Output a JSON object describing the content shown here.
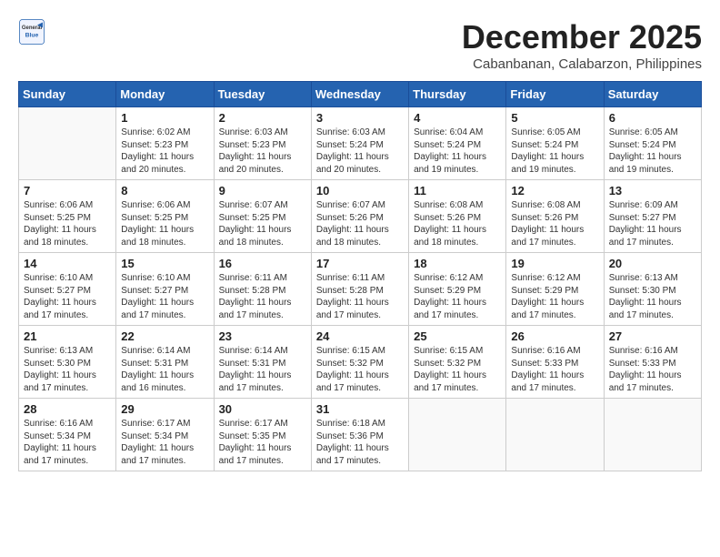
{
  "logo": {
    "general": "General",
    "blue": "Blue"
  },
  "header": {
    "title": "December 2025",
    "subtitle": "Cabanbanan, Calabarzon, Philippines"
  },
  "weekdays": [
    "Sunday",
    "Monday",
    "Tuesday",
    "Wednesday",
    "Thursday",
    "Friday",
    "Saturday"
  ],
  "weeks": [
    [
      {
        "day": "",
        "info": ""
      },
      {
        "day": "1",
        "info": "Sunrise: 6:02 AM\nSunset: 5:23 PM\nDaylight: 11 hours\nand 20 minutes."
      },
      {
        "day": "2",
        "info": "Sunrise: 6:03 AM\nSunset: 5:23 PM\nDaylight: 11 hours\nand 20 minutes."
      },
      {
        "day": "3",
        "info": "Sunrise: 6:03 AM\nSunset: 5:24 PM\nDaylight: 11 hours\nand 20 minutes."
      },
      {
        "day": "4",
        "info": "Sunrise: 6:04 AM\nSunset: 5:24 PM\nDaylight: 11 hours\nand 19 minutes."
      },
      {
        "day": "5",
        "info": "Sunrise: 6:05 AM\nSunset: 5:24 PM\nDaylight: 11 hours\nand 19 minutes."
      },
      {
        "day": "6",
        "info": "Sunrise: 6:05 AM\nSunset: 5:24 PM\nDaylight: 11 hours\nand 19 minutes."
      }
    ],
    [
      {
        "day": "7",
        "info": "Sunrise: 6:06 AM\nSunset: 5:25 PM\nDaylight: 11 hours\nand 18 minutes."
      },
      {
        "day": "8",
        "info": "Sunrise: 6:06 AM\nSunset: 5:25 PM\nDaylight: 11 hours\nand 18 minutes."
      },
      {
        "day": "9",
        "info": "Sunrise: 6:07 AM\nSunset: 5:25 PM\nDaylight: 11 hours\nand 18 minutes."
      },
      {
        "day": "10",
        "info": "Sunrise: 6:07 AM\nSunset: 5:26 PM\nDaylight: 11 hours\nand 18 minutes."
      },
      {
        "day": "11",
        "info": "Sunrise: 6:08 AM\nSunset: 5:26 PM\nDaylight: 11 hours\nand 18 minutes."
      },
      {
        "day": "12",
        "info": "Sunrise: 6:08 AM\nSunset: 5:26 PM\nDaylight: 11 hours\nand 17 minutes."
      },
      {
        "day": "13",
        "info": "Sunrise: 6:09 AM\nSunset: 5:27 PM\nDaylight: 11 hours\nand 17 minutes."
      }
    ],
    [
      {
        "day": "14",
        "info": "Sunrise: 6:10 AM\nSunset: 5:27 PM\nDaylight: 11 hours\nand 17 minutes."
      },
      {
        "day": "15",
        "info": "Sunrise: 6:10 AM\nSunset: 5:27 PM\nDaylight: 11 hours\nand 17 minutes."
      },
      {
        "day": "16",
        "info": "Sunrise: 6:11 AM\nSunset: 5:28 PM\nDaylight: 11 hours\nand 17 minutes."
      },
      {
        "day": "17",
        "info": "Sunrise: 6:11 AM\nSunset: 5:28 PM\nDaylight: 11 hours\nand 17 minutes."
      },
      {
        "day": "18",
        "info": "Sunrise: 6:12 AM\nSunset: 5:29 PM\nDaylight: 11 hours\nand 17 minutes."
      },
      {
        "day": "19",
        "info": "Sunrise: 6:12 AM\nSunset: 5:29 PM\nDaylight: 11 hours\nand 17 minutes."
      },
      {
        "day": "20",
        "info": "Sunrise: 6:13 AM\nSunset: 5:30 PM\nDaylight: 11 hours\nand 17 minutes."
      }
    ],
    [
      {
        "day": "21",
        "info": "Sunrise: 6:13 AM\nSunset: 5:30 PM\nDaylight: 11 hours\nand 17 minutes."
      },
      {
        "day": "22",
        "info": "Sunrise: 6:14 AM\nSunset: 5:31 PM\nDaylight: 11 hours\nand 16 minutes."
      },
      {
        "day": "23",
        "info": "Sunrise: 6:14 AM\nSunset: 5:31 PM\nDaylight: 11 hours\nand 17 minutes."
      },
      {
        "day": "24",
        "info": "Sunrise: 6:15 AM\nSunset: 5:32 PM\nDaylight: 11 hours\nand 17 minutes."
      },
      {
        "day": "25",
        "info": "Sunrise: 6:15 AM\nSunset: 5:32 PM\nDaylight: 11 hours\nand 17 minutes."
      },
      {
        "day": "26",
        "info": "Sunrise: 6:16 AM\nSunset: 5:33 PM\nDaylight: 11 hours\nand 17 minutes."
      },
      {
        "day": "27",
        "info": "Sunrise: 6:16 AM\nSunset: 5:33 PM\nDaylight: 11 hours\nand 17 minutes."
      }
    ],
    [
      {
        "day": "28",
        "info": "Sunrise: 6:16 AM\nSunset: 5:34 PM\nDaylight: 11 hours\nand 17 minutes."
      },
      {
        "day": "29",
        "info": "Sunrise: 6:17 AM\nSunset: 5:34 PM\nDaylight: 11 hours\nand 17 minutes."
      },
      {
        "day": "30",
        "info": "Sunrise: 6:17 AM\nSunset: 5:35 PM\nDaylight: 11 hours\nand 17 minutes."
      },
      {
        "day": "31",
        "info": "Sunrise: 6:18 AM\nSunset: 5:36 PM\nDaylight: 11 hours\nand 17 minutes."
      },
      {
        "day": "",
        "info": ""
      },
      {
        "day": "",
        "info": ""
      },
      {
        "day": "",
        "info": ""
      }
    ]
  ]
}
